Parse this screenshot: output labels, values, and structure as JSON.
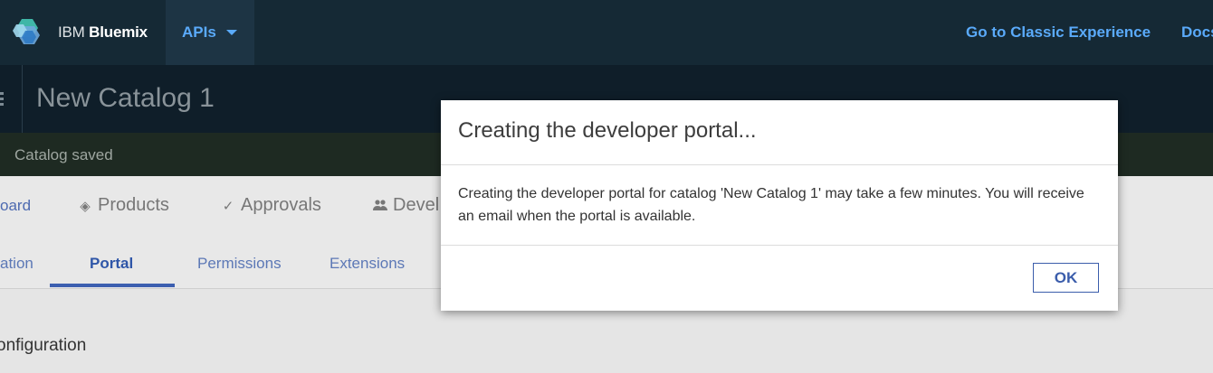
{
  "topbar": {
    "brand_prefix": "IBM",
    "brand_name": "Bluemix",
    "apis_label": "APIs",
    "links": [
      "Go to Classic Experience",
      "Docs"
    ],
    "logo_icon": "bluemix-logo-icon",
    "accent_color": "#5aaafa"
  },
  "titlebar": {
    "catalog_title": "New Catalog 1"
  },
  "notice": {
    "text": "Catalog saved"
  },
  "main_tabs": [
    {
      "label": "oard",
      "icon": null
    },
    {
      "label": "Products",
      "icon": "layers-icon"
    },
    {
      "label": "Approvals",
      "icon": "checkmark-icon"
    },
    {
      "label": "Devel",
      "icon": "people-icon"
    }
  ],
  "sub_tabs": [
    {
      "label": "ation",
      "active": false
    },
    {
      "label": "Portal",
      "active": true
    },
    {
      "label": "Permissions",
      "active": false
    },
    {
      "label": "Extensions",
      "active": false
    }
  ],
  "content": {
    "section_heading": "onfiguration"
  },
  "modal": {
    "title": "Creating the developer portal...",
    "body": "Creating the developer portal for catalog 'New Catalog 1' may take a few minutes. You will receive an email when the portal is available.",
    "ok_label": "OK"
  }
}
